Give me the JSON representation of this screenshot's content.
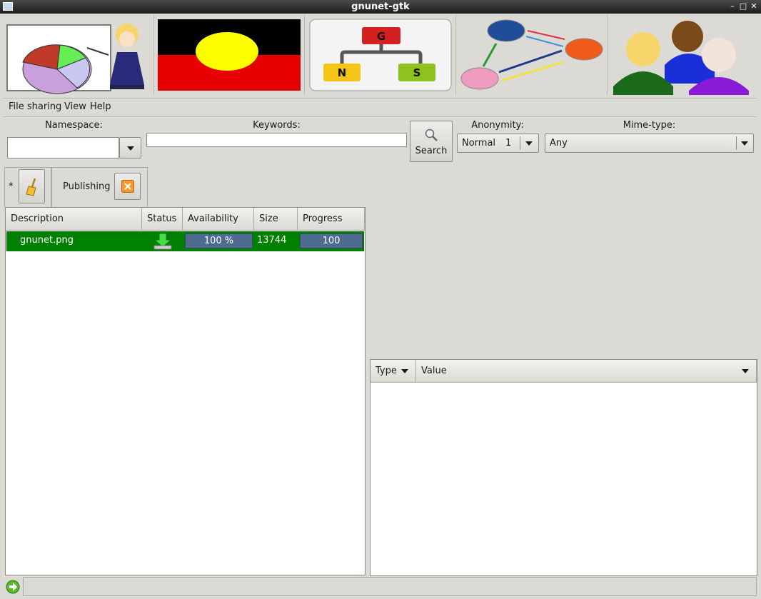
{
  "window": {
    "title": "gnunet-gtk"
  },
  "menu": {
    "file_sharing": "File sharing",
    "view": "View",
    "help": "Help"
  },
  "search": {
    "namespace_label": "Namespace:",
    "keywords_label": "Keywords:",
    "search_button": "Search",
    "anonymity_label": "Anonymity:",
    "anonymity_mode": "Normal",
    "anonymity_level": "1",
    "mimetype_label": "Mime-type:",
    "mimetype_value": "Any"
  },
  "tabs": [
    {
      "label": "*"
    },
    {
      "label": "Publishing"
    }
  ],
  "results": {
    "columns": [
      "Description",
      "Status",
      "Availability",
      "Size",
      "Progress"
    ],
    "rows": [
      {
        "description": "gnunet.png",
        "availability": "100 %",
        "availability_fraction": 1.0,
        "size": "13744",
        "progress": "100",
        "progress_fraction": 1.0
      }
    ]
  },
  "metadata": {
    "columns": [
      "Type",
      "Value"
    ]
  },
  "colors": {
    "selected_row": "#008000",
    "progress_bar": "#4f6b8f",
    "titlebar": "#2a2a2a"
  }
}
